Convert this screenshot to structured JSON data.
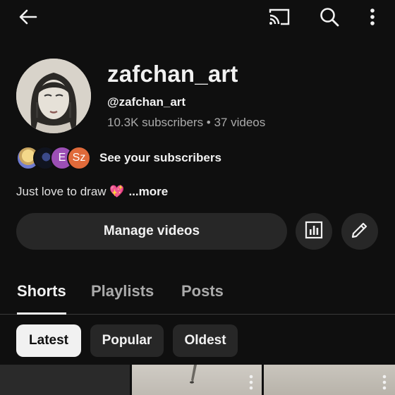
{
  "header": {
    "icons": [
      "back-icon",
      "cast-icon",
      "search-icon",
      "more-vert-icon"
    ]
  },
  "channel": {
    "name": "zafchan_art",
    "handle": "@zafchan_art",
    "stats": "10.3K subscribers • 37 videos"
  },
  "subscribers": {
    "avatars": [
      "",
      "",
      "E",
      "Sz"
    ],
    "label": "See your subscribers"
  },
  "bio": {
    "text": "Just love to draw 💖",
    "more": "...more"
  },
  "actions": {
    "manage_videos": "Manage videos",
    "icons": [
      "analytics-icon",
      "edit-pencil-icon"
    ]
  },
  "tabs": [
    {
      "label": "Shorts",
      "active": true
    },
    {
      "label": "Playlists",
      "active": false
    },
    {
      "label": "Posts",
      "active": false
    }
  ],
  "chips": [
    {
      "label": "Latest",
      "selected": true
    },
    {
      "label": "Popular",
      "selected": false
    },
    {
      "label": "Oldest",
      "selected": false
    }
  ],
  "colors": {
    "background": "#0f0f0f",
    "surface": "#272727",
    "text": "#f1f1f1",
    "secondary_text": "#aaaaaa"
  }
}
